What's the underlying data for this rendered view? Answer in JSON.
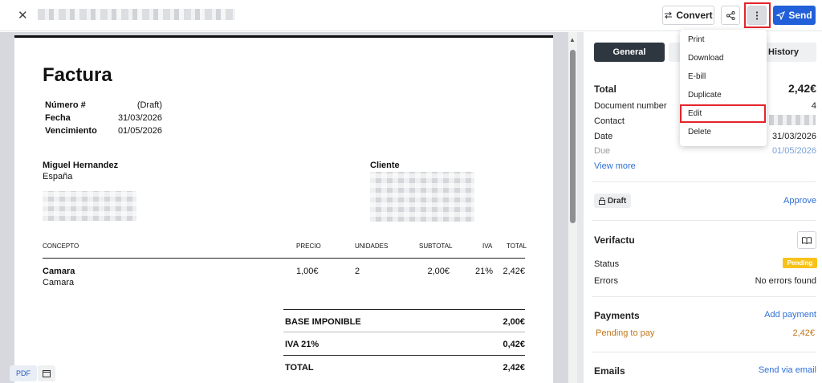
{
  "topbar": {
    "close_icon": "close-icon",
    "convert_label": "Convert",
    "send_label": "Send",
    "accent": "#2160d8",
    "highlight": "#e4242b"
  },
  "menu": {
    "items": [
      "Print",
      "Download",
      "E-bill",
      "Duplicate",
      "Edit",
      "Delete"
    ]
  },
  "invoice": {
    "title": "Factura",
    "meta": [
      {
        "label": "Número #",
        "value": "(Draft)"
      },
      {
        "label": "Fecha",
        "value": "31/03/2026"
      },
      {
        "label": "Vencimiento",
        "value": "01/05/2026"
      }
    ],
    "issuer_name": "Miguel Hernandez",
    "issuer_country": "España",
    "client_label": "Cliente",
    "columns": [
      "CONCEPTO",
      "PRECIO",
      "UNIDADES",
      "SUBTOTAL",
      "IVA",
      "TOTAL"
    ],
    "rows": [
      {
        "concept": "Camara",
        "desc": "Camara",
        "price": "1,00€",
        "units": "2",
        "subtotal": "2,00€",
        "iva": "21%",
        "total": "2,42€"
      }
    ],
    "totals": [
      {
        "label": "BASE IMPONIBLE",
        "value": "2,00€"
      },
      {
        "label": "IVA 21%",
        "value": "0,42€"
      },
      {
        "label": "TOTAL",
        "value": "2,42€"
      }
    ]
  },
  "viewer": {
    "pdf_label": "PDF"
  },
  "panel": {
    "tabs": [
      "General",
      "",
      "History"
    ],
    "total_label": "Total",
    "total_value": "2,42€",
    "fields": [
      {
        "label": "Document number",
        "value": "4"
      },
      {
        "label": "Contact",
        "value": ""
      },
      {
        "label": "Date",
        "value": "31/03/2026"
      },
      {
        "label": "Due",
        "value": "01/05/2026"
      }
    ],
    "view_more": "View more",
    "draft_label": "Draft",
    "approve_label": "Approve",
    "verifactu": {
      "title": "Verifactu",
      "status_label": "Status",
      "status_value": "Pending",
      "errors_label": "Errors",
      "errors_value": "No errors found"
    },
    "payments": {
      "title": "Payments",
      "add_label": "Add payment",
      "pending_label": "Pending to pay",
      "pending_value": "2,42€",
      "pending_color": "#c0751a"
    },
    "emails": {
      "title": "Emails",
      "send_label": "Send via email"
    }
  }
}
